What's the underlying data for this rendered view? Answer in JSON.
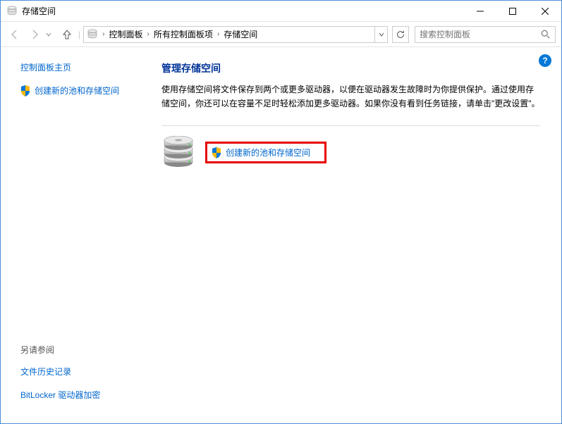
{
  "window": {
    "title": "存储空间"
  },
  "breadcrumb": {
    "items": [
      "控制面板",
      "所有控制面板项",
      "存储空间"
    ]
  },
  "search": {
    "placeholder": "搜索控制面板"
  },
  "sidebar": {
    "home_link": "控制面板主页",
    "create_link": "创建新的池和存储空间",
    "see_also": "另请参阅",
    "file_history": "文件历史记录",
    "bitlocker": "BitLocker 驱动器加密"
  },
  "main": {
    "title": "管理存储空间",
    "description": "使用存储空间将文件保存到两个或更多驱动器，以便在驱动器发生故障时为你提供保护。通过使用存储空间，你还可以在容量不足时轻松添加更多驱动器。如果你没有看到任务链接，请单击\"更改设置\"。",
    "action_link": "创建新的池和存储空间"
  }
}
